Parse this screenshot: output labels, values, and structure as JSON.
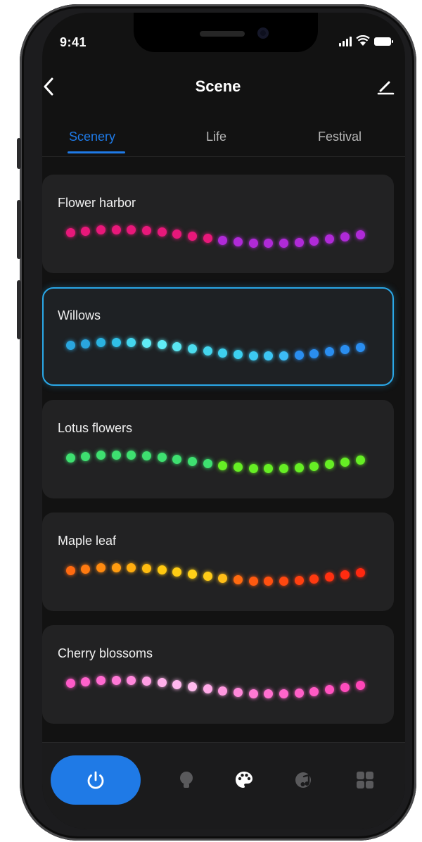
{
  "status": {
    "time": "9:41"
  },
  "header": {
    "title": "Scene"
  },
  "tabs": [
    {
      "label": "Scenery",
      "active": true
    },
    {
      "label": "Life",
      "active": false
    },
    {
      "label": "Festival",
      "active": false
    }
  ],
  "scenes": [
    {
      "name": "Flower harbor",
      "selected": false,
      "colors": [
        "#e8187a",
        "#e8187a",
        "#e8187a",
        "#e8187a",
        "#e8187a",
        "#e8187a",
        "#e8187a",
        "#e8187a",
        "#e8187a",
        "#e8187a",
        "#b02ad8",
        "#b02ad8",
        "#b02ad8",
        "#b02ad8",
        "#b02ad8",
        "#b02ad8",
        "#b02ad8",
        "#b02ad8",
        "#b02ad8",
        "#b02ad8"
      ]
    },
    {
      "name": "Willows",
      "selected": true,
      "colors": [
        "#2aa6de",
        "#2aa6de",
        "#2ab2e0",
        "#30c0e6",
        "#44d6ee",
        "#60ecf6",
        "#60ecf6",
        "#5ae6f2",
        "#4cdcee",
        "#44d6ee",
        "#3ed0ee",
        "#3cd0f0",
        "#3ccaf2",
        "#3cc6f4",
        "#3cbcf6",
        "#2a8ef0",
        "#2a8ef0",
        "#2a8ef0",
        "#2a8ef0",
        "#2a8ef0"
      ]
    },
    {
      "name": "Lotus flowers",
      "selected": false,
      "colors": [
        "#3ee070",
        "#3ee070",
        "#3ee070",
        "#3ee070",
        "#3ee070",
        "#3ee070",
        "#3ee070",
        "#3ee070",
        "#3ee070",
        "#3ee070",
        "#66ee24",
        "#66ee24",
        "#66ee24",
        "#66ee24",
        "#66ee24",
        "#66ee24",
        "#66ee24",
        "#66ee24",
        "#66ee24",
        "#66ee24"
      ]
    },
    {
      "name": "Maple leaf",
      "selected": false,
      "colors": [
        "#ff6a10",
        "#ff7a10",
        "#ff8a10",
        "#ff9c10",
        "#ffac10",
        "#ffbc10",
        "#ffc810",
        "#ffcc14",
        "#ffd018",
        "#ffcc18",
        "#ffbe18",
        "#ff6a10",
        "#ff5a10",
        "#ff5010",
        "#ff4810",
        "#ff4010",
        "#ff3a10",
        "#ff3010",
        "#ff2c10",
        "#ff2810"
      ]
    },
    {
      "name": "Cherry blossoms",
      "selected": false,
      "colors": [
        "#ff5ac8",
        "#ff62cc",
        "#ff6ad0",
        "#ff78d6",
        "#ff88dc",
        "#ff9ee4",
        "#ffb0ea",
        "#ffb8ee",
        "#ffbcee",
        "#ffaae8",
        "#ff98e0",
        "#ff88da",
        "#ff7ad4",
        "#ff70d0",
        "#ff66cc",
        "#ff60c8",
        "#ff5ac4",
        "#ff52c0",
        "#ff4cbc",
        "#ff46b8"
      ]
    }
  ],
  "bottom_nav": [
    {
      "icon": "power-icon",
      "active": true
    },
    {
      "icon": "bulb-icon",
      "active": false
    },
    {
      "icon": "palette-icon",
      "active": true
    },
    {
      "icon": "music-icon",
      "active": false
    },
    {
      "icon": "grid-icon",
      "active": false
    }
  ]
}
